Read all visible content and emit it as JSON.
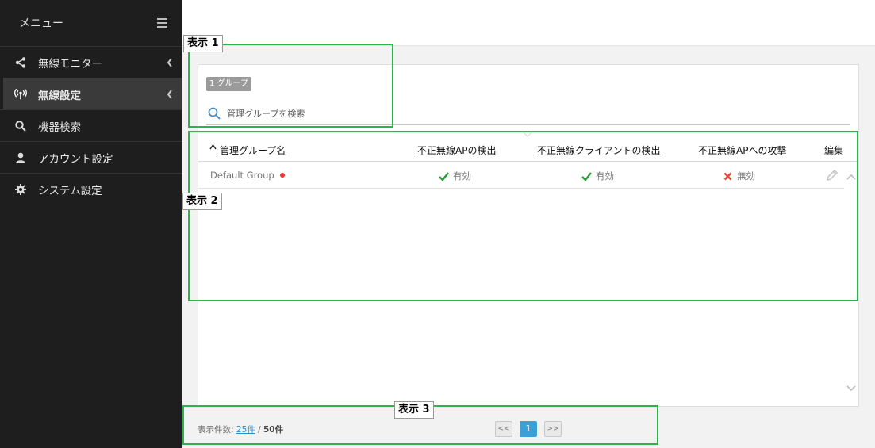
{
  "sidebar": {
    "title": "メニュー",
    "items": [
      {
        "label": "無線モニター",
        "icon": "share-icon"
      },
      {
        "label": "無線設定",
        "icon": "wireless-antenna-icon",
        "active": true
      },
      {
        "label": "機器検索",
        "icon": "search-icon"
      },
      {
        "label": "アカウント設定",
        "icon": "user-icon"
      },
      {
        "label": "システム設定",
        "icon": "gear-icon"
      }
    ]
  },
  "main": {
    "group_badge": "1 グループ",
    "search": {
      "placeholder": "管理グループを検索",
      "value": ""
    },
    "table": {
      "columns": [
        "管理グループ名",
        "不正無線APの検出",
        "不正無線クライアントの検出",
        "不正無線APへの攻撃",
        "編集"
      ],
      "sort_indicator": "^",
      "rows": [
        {
          "name": "Default Group",
          "ap_detect": "有効",
          "client_detect": "有効",
          "ap_attack": "無効"
        }
      ]
    },
    "footer": {
      "count_label": "表示件数:",
      "per_page": "25件",
      "separator": "/",
      "total": "50件"
    },
    "pagination": {
      "prev": "<<",
      "current": "1",
      "next": ">>"
    }
  },
  "annotations": {
    "display1": "表示 1",
    "display2": "表示 2",
    "display3": "表示 3"
  },
  "colors": {
    "sidebar_bg": "#1e1e1e",
    "active_item_bg": "#3a3a3a",
    "enabled_check": "#2a9d3a",
    "disabled_cross": "#e04a3a",
    "annotation_border": "#2db34a",
    "pager_current": "#3aa0d8"
  }
}
